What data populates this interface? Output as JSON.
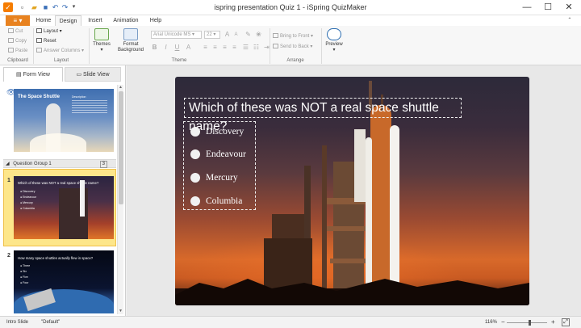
{
  "titlebar": {
    "title": "ispring presentation Quiz 1 - iSpring QuizMaker",
    "quick_access": [
      "save-icon",
      "open-icon",
      "undo-icon",
      "redo-icon"
    ],
    "window_controls": {
      "minimize": "—",
      "maximize": "☐",
      "close": "✕"
    }
  },
  "tabs": {
    "file": "▾",
    "items": [
      {
        "label": "Home",
        "active": false
      },
      {
        "label": "Design",
        "active": true
      },
      {
        "label": "Insert",
        "active": false
      },
      {
        "label": "Animation",
        "active": false
      },
      {
        "label": "Help",
        "active": false
      }
    ]
  },
  "ribbon": {
    "clipboard": {
      "label": "Clipboard",
      "cut": "Cut",
      "copy": "Copy",
      "paste": "Paste"
    },
    "layout": {
      "label": "Layout",
      "layout": "Layout",
      "reset": "Reset",
      "answer_columns": "Answer Columns"
    },
    "theme": {
      "label": "Theme",
      "themes": "Themes",
      "format_background": "Format Background",
      "font_name": "Arial Unicode MS",
      "font_size": "22",
      "bold": "B",
      "italic": "I",
      "underline": "U"
    },
    "arrange": {
      "label": "Arrange",
      "bring_to_front": "Bring to Front",
      "send_to_back": "Send to Back"
    },
    "preview": {
      "label": "Preview"
    }
  },
  "left_panel": {
    "form_view": "Form View",
    "slide_view": "Slide View",
    "intro_slide": {
      "title": "The Space Shuttle",
      "subtitle": "Description"
    },
    "group": {
      "label": "Question Group 1",
      "count": "3"
    },
    "slides": [
      {
        "number": "1",
        "question": "Which of these was NOT a real space shuttle name?",
        "answers": [
          "Discovery",
          "Endeavour",
          "Mercury",
          "Columbia"
        ]
      },
      {
        "number": "2",
        "question": "How many space shuttles actually flew in space?",
        "answers": [
          "Three",
          "Six",
          "Five",
          "Four"
        ]
      }
    ]
  },
  "slide": {
    "question": "Which of these was NOT a real space shuttle name?",
    "answers": [
      "Discovery",
      "Endeavour",
      "Mercury",
      "Columbia"
    ]
  },
  "statusbar": {
    "left": "Intro Slide",
    "theme": "\"Default\"",
    "zoom": "116%"
  }
}
